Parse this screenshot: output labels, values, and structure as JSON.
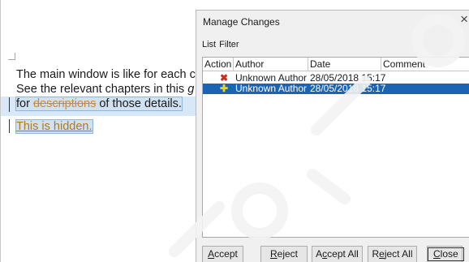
{
  "document": {
    "line1": "The main window is like for each c",
    "line2_prefix": "See the relevant chapters in this ",
    "line2_italic": "g",
    "line3_prefix": "for ",
    "line3_deleted": "descriptions",
    "line3_suffix": " of those details.",
    "line4": "This is hidden."
  },
  "dialog": {
    "title": "Manage Changes",
    "close_glyph": "×",
    "tabs": [
      "List",
      "Filter"
    ],
    "columns": [
      "Action",
      "Author",
      "Date",
      "Comment"
    ],
    "rows": [
      {
        "action_icon": "delete-x-icon",
        "icon_glyph": "✖",
        "author": "Unknown Author",
        "date": "28/05/2018 15:17",
        "comment": "",
        "selected": false
      },
      {
        "action_icon": "insert-plus-icon",
        "icon_glyph": "✚",
        "author": "Unknown Author",
        "date": "28/05/2018 15:17",
        "comment": "",
        "selected": true
      }
    ],
    "buttons": {
      "accept": {
        "mnemonic": "A",
        "rest": "ccept"
      },
      "reject": {
        "mnemonic": "R",
        "rest": "eject"
      },
      "accept_all_pre": "A",
      "accept_all_mn": "c",
      "accept_all_post": "cept All",
      "reject_all_pre": "R",
      "reject_all_mn": "e",
      "reject_all_post": "ject All",
      "close": {
        "mnemonic": "C",
        "rest": "lose"
      }
    }
  },
  "colors": {
    "selection": "#1b64b4",
    "deleted_text": "#d8881e",
    "delete_icon": "#d42a1a",
    "insert_icon": "#f3d21a"
  }
}
